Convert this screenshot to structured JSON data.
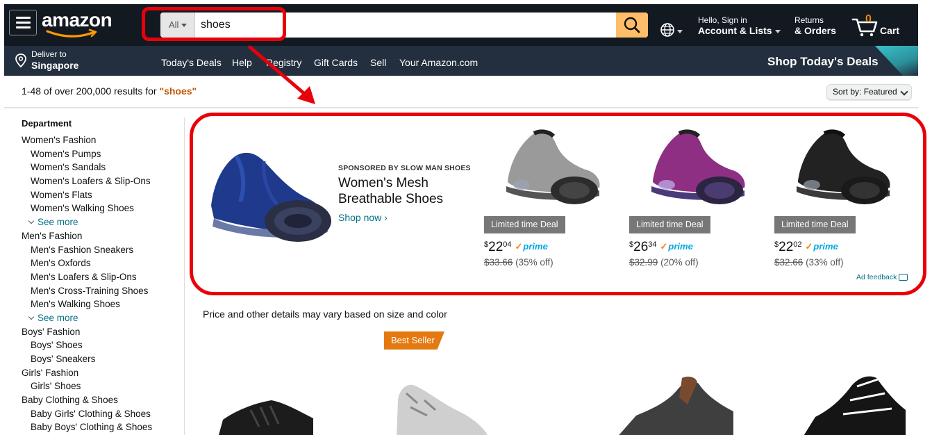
{
  "header": {
    "logo_text": "amazon",
    "search": {
      "department": "All",
      "query": "shoes"
    },
    "account": {
      "line1": "Hello, Sign in",
      "line2": "Account & Lists"
    },
    "orders": {
      "line1": "Returns",
      "line2": "& Orders"
    },
    "cart": {
      "count": "0",
      "label": "Cart"
    }
  },
  "subnav": {
    "deliver": {
      "line1": "Deliver to",
      "line2": "Singapore"
    },
    "links": [
      "Today's Deals",
      "Help",
      "Registry",
      "Gift Cards",
      "Sell",
      "Your Amazon.com"
    ],
    "promo": "Shop Today's Deals"
  },
  "results": {
    "summary": "1-48 of over 200,000 results for ",
    "term": "\"shoes\"",
    "sort_label": "Sort by:",
    "sort_value": "Featured"
  },
  "sidebar": {
    "title": "Department",
    "items": [
      {
        "label": "Women's Fashion",
        "level": 1
      },
      {
        "label": "Women's Pumps",
        "level": 2
      },
      {
        "label": "Women's Sandals",
        "level": 2
      },
      {
        "label": "Women's Loafers & Slip-Ons",
        "level": 2
      },
      {
        "label": "Women's Flats",
        "level": 2
      },
      {
        "label": "Women's Walking Shoes",
        "level": 2
      },
      {
        "label": "See more",
        "level": "more"
      },
      {
        "label": "Men's Fashion",
        "level": 1
      },
      {
        "label": "Men's Fashion Sneakers",
        "level": 2
      },
      {
        "label": "Men's Oxfords",
        "level": 2
      },
      {
        "label": "Men's Loafers & Slip-Ons",
        "level": 2
      },
      {
        "label": "Men's Cross-Training Shoes",
        "level": 2
      },
      {
        "label": "Men's Walking Shoes",
        "level": 2
      },
      {
        "label": "See more",
        "level": "more"
      },
      {
        "label": "Boys' Fashion",
        "level": 1
      },
      {
        "label": "Boys' Shoes",
        "level": 2
      },
      {
        "label": "Boys' Sneakers",
        "level": 2
      },
      {
        "label": "Girls' Fashion",
        "level": 1
      },
      {
        "label": "Girls' Shoes",
        "level": 2
      },
      {
        "label": "Baby Clothing & Shoes",
        "level": 1
      },
      {
        "label": "Baby Girls' Clothing & Shoes",
        "level": 2
      },
      {
        "label": "Baby Boys' Clothing & Shoes",
        "level": 2
      }
    ]
  },
  "sponsored": {
    "label": "SPONSORED BY SLOW MAN SHOES",
    "headline": "Women's Mesh Breathable Shoes",
    "cta": "Shop now",
    "products": [
      {
        "badge": "Limited time Deal",
        "symbol": "$",
        "whole": "22",
        "fraction": "04",
        "prime": "prime",
        "was": "$33.66",
        "off": "(35% off)",
        "color": "#9a9a9a"
      },
      {
        "badge": "Limited time Deal",
        "symbol": "$",
        "whole": "26",
        "fraction": "34",
        "prime": "prime",
        "was": "$32.99",
        "off": "(20% off)",
        "color": "#8e2f83"
      },
      {
        "badge": "Limited time Deal",
        "symbol": "$",
        "whole": "22",
        "fraction": "02",
        "prime": "prime",
        "was": "$32.66",
        "off": "(33% off)",
        "color": "#222222"
      }
    ],
    "ad_feedback": "Ad feedback"
  },
  "listing": {
    "price_note": "Price and other details may vary based on size and color",
    "best_seller": "Best Seller"
  },
  "colors": {
    "nav_top": "#131921",
    "nav_sub": "#232f3e",
    "search_button": "#febd69",
    "annotation": "#e8000b",
    "link": "#007185",
    "best_seller": "#e47911"
  }
}
